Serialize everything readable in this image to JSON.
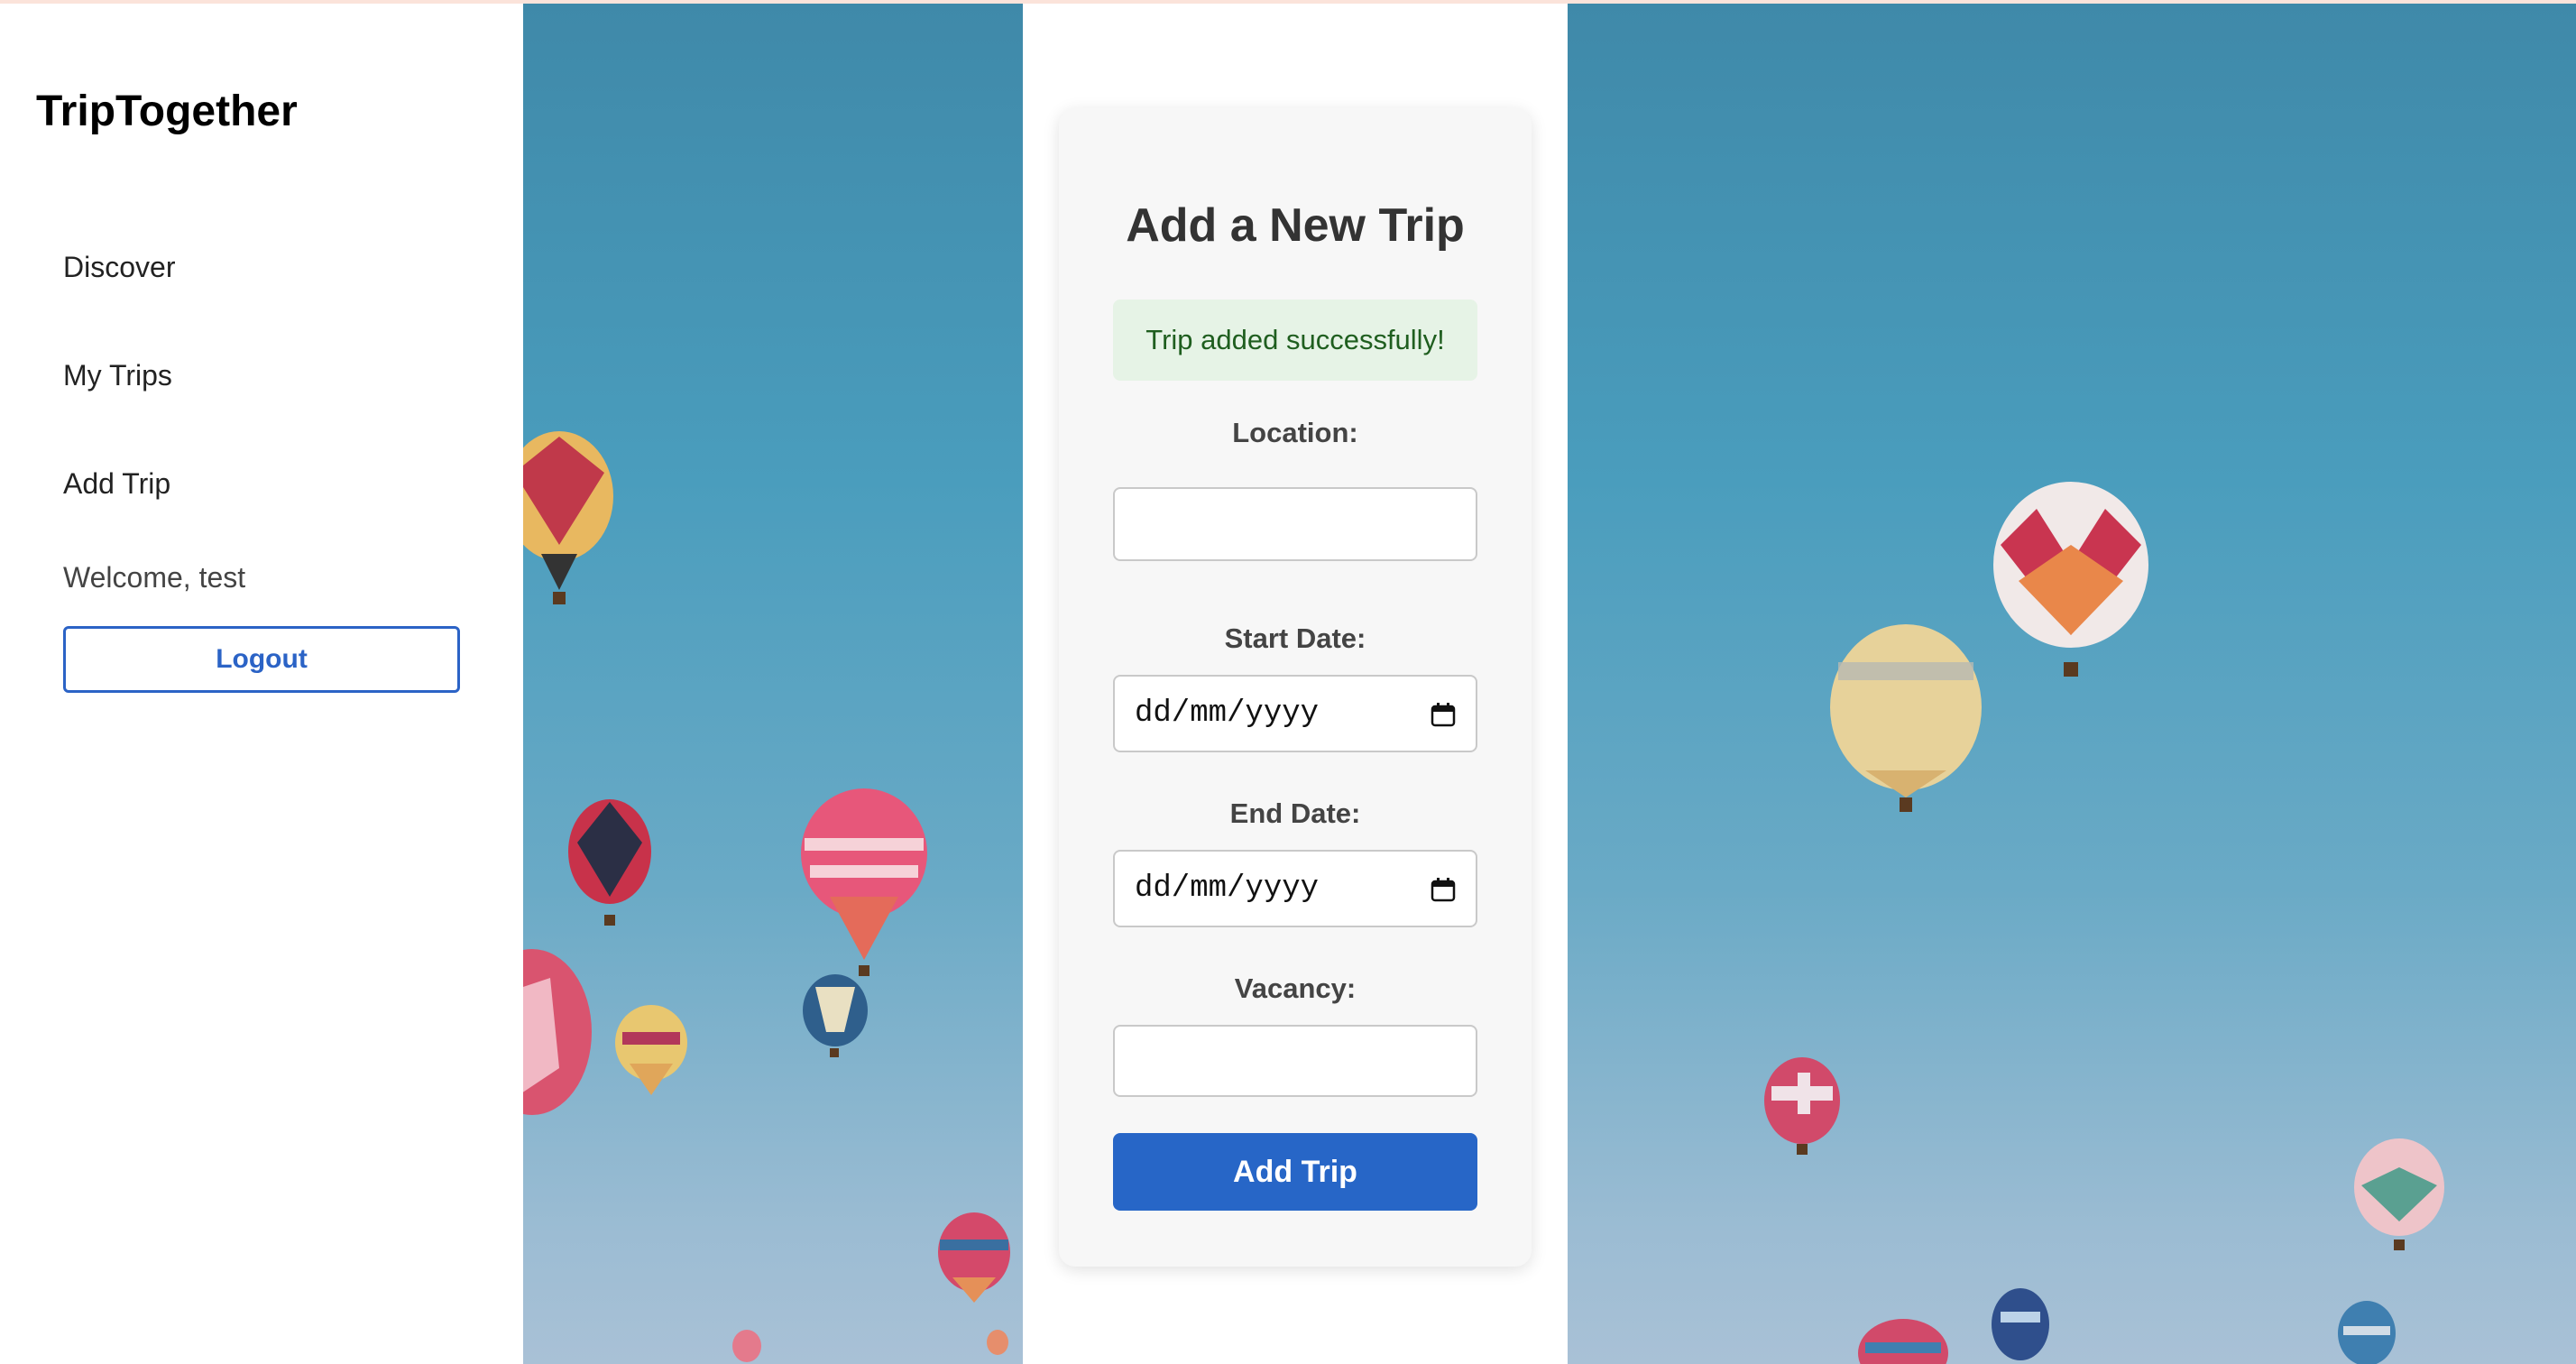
{
  "app": {
    "title": "TripTogether"
  },
  "sidebar": {
    "items": [
      {
        "label": "Discover"
      },
      {
        "label": "My Trips"
      },
      {
        "label": "Add Trip"
      }
    ],
    "welcome": "Welcome, test",
    "logout_label": "Logout"
  },
  "form": {
    "title": "Add a New Trip",
    "success_message": "Trip added successfully!",
    "location": {
      "label": "Location:",
      "value": ""
    },
    "start_date": {
      "label": "Start Date:",
      "value": "dd/mm/yyyy"
    },
    "end_date": {
      "label": "End Date:",
      "value": "dd/mm/yyyy"
    },
    "vacancy": {
      "label": "Vacancy:",
      "value": ""
    },
    "submit_label": "Add Trip"
  },
  "colors": {
    "accent": "#2766c7",
    "success_bg": "#e6f3e6",
    "success_text": "#1f5e1f",
    "sky_top": "#3f89a9",
    "sky_bottom": "#a9c1d6"
  },
  "icons": {
    "calendar": "calendar-icon",
    "balloon": "hot-air-balloon-icon"
  }
}
